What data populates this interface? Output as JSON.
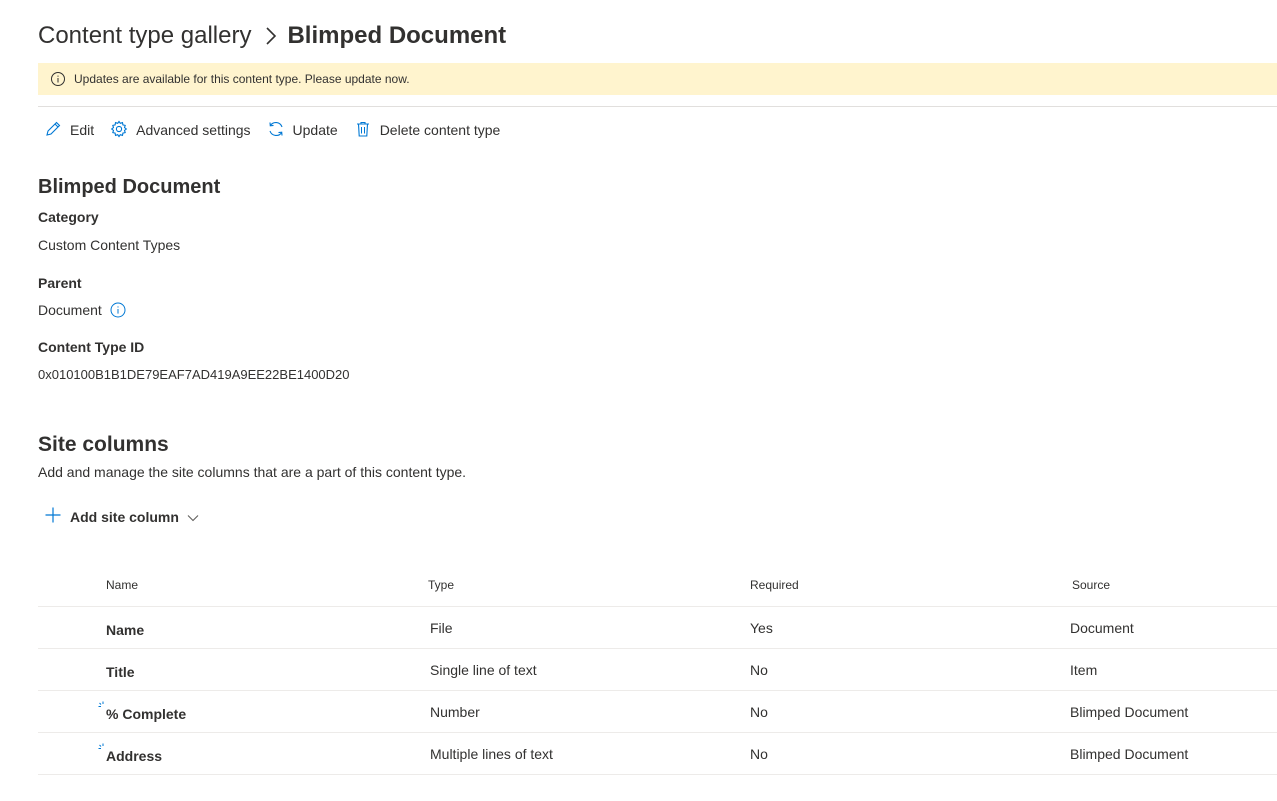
{
  "breadcrumb": {
    "parent": "Content type gallery",
    "current": "Blimped Document"
  },
  "banner": {
    "message": "Updates are available for this content type. Please update now.",
    "icon": "info-icon",
    "color": "#fff4ce"
  },
  "commands": {
    "edit": "Edit",
    "advanced": "Advanced settings",
    "update": "Update",
    "delete": "Delete content type"
  },
  "details": {
    "title": "Blimped Document",
    "category_label": "Category",
    "category_value": "Custom Content Types",
    "parent_label": "Parent",
    "parent_value": "Document",
    "id_label": "Content Type ID",
    "id_value": "0x010100B1B1DE79EAF7AD419A9EE22BE1400D20"
  },
  "site_columns": {
    "title": "Site columns",
    "description": "Add and manage the site columns that are a part of this content type.",
    "add_label": "Add site column"
  },
  "table": {
    "headers": [
      "Name",
      "Type",
      "Required",
      "Source"
    ],
    "rows": [
      {
        "name": "Name",
        "type": "File",
        "required": "Yes",
        "source": "Document"
      },
      {
        "name": "Title",
        "type": "Single line of text",
        "required": "No",
        "source": "Item"
      },
      {
        "name": "% Complete",
        "type": "Number",
        "required": "No",
        "source": "Blimped Document"
      },
      {
        "name": "Address",
        "type": "Multiple lines of text",
        "required": "No",
        "source": "Blimped Document"
      }
    ]
  },
  "colors": {
    "accent": "#0078d4",
    "text": "#323130",
    "divider": "#e1dfdd"
  }
}
